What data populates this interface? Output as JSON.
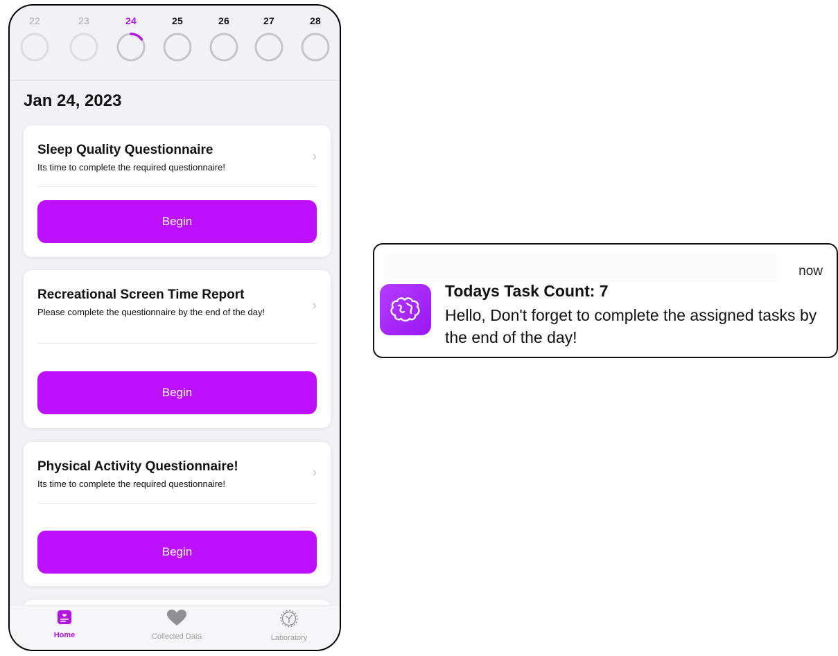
{
  "week": {
    "days": [
      {
        "label": "22",
        "state": "past"
      },
      {
        "label": "23",
        "state": "past"
      },
      {
        "label": "24",
        "state": "today",
        "progress": 0.15
      },
      {
        "label": "25",
        "state": "future"
      },
      {
        "label": "26",
        "state": "future"
      },
      {
        "label": "27",
        "state": "future"
      },
      {
        "label": "28",
        "state": "future"
      }
    ]
  },
  "date_heading": "Jan 24, 2023",
  "cards": [
    {
      "title": "Sleep Quality Questionnaire",
      "subtitle": "Its time to complete the required questionnaire!",
      "button": "Begin"
    },
    {
      "title": "Recreational Screen Time Report",
      "subtitle": "Please complete the questionnaire by the end of the day!",
      "button": "Begin"
    },
    {
      "title": "Physical Activity Questionnaire!",
      "subtitle": "Its time to complete the required questionnaire!",
      "button": "Begin"
    }
  ],
  "tabbar": {
    "home": "Home",
    "collected": "Collected Data",
    "laboratory": "Laboratory"
  },
  "notification": {
    "time": "now",
    "title": "Todays Task Count: 7",
    "body": "Hello, Don't forget to complete the assigned tasks by the end of the day!",
    "icon": "brain-icon"
  },
  "colors": {
    "accent": "#bd10ff",
    "today_text": "#b114e0",
    "ring": "#d1d1d6"
  }
}
